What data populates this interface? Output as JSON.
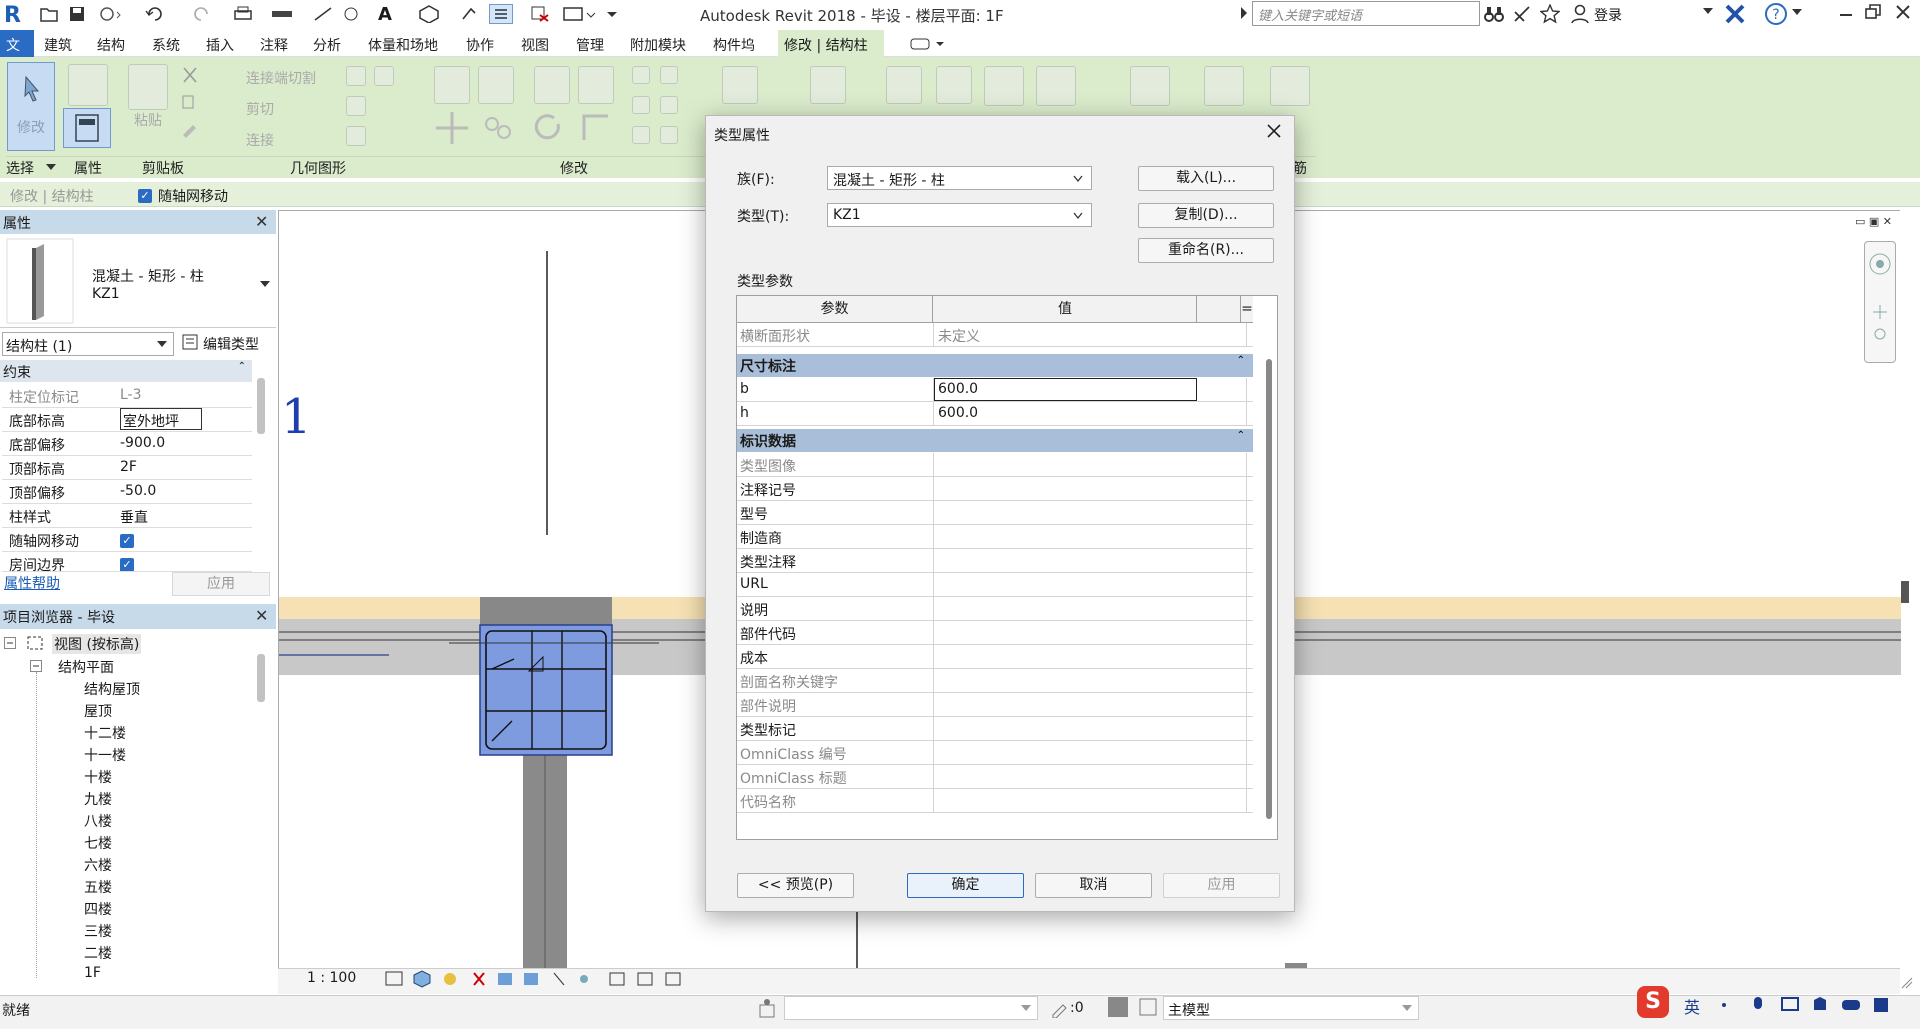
{
  "app": {
    "title": "Autodesk Revit 2018 -    毕设 - 楼层平面: 1F",
    "search_placeholder": "键入关键字或短语",
    "login": "登录",
    "logo": "R"
  },
  "menu": {
    "file": "文件",
    "items": [
      "建筑",
      "结构",
      "系统",
      "插入",
      "注释",
      "分析",
      "体量和场地",
      "协作",
      "视图",
      "管理",
      "附加模块",
      "构件坞"
    ],
    "active": "修改 | 结构柱"
  },
  "ribbon": {
    "modify_label": "修改",
    "paste_label": "粘贴",
    "cut_join": "连接端切割",
    "cut": "剪切",
    "join": "连接",
    "panel_labels": {
      "select": "选择",
      "props": "属性",
      "clipboard": "剪贴板",
      "geometry": "几何图形",
      "modify": "修改",
      "right": "筋"
    }
  },
  "options_bar": {
    "context": "修改 | 结构柱",
    "move_with_grids": "随轴网移动"
  },
  "properties": {
    "title": "属性",
    "family": "混凝土 - 矩形 - 柱",
    "type": "KZ1",
    "filter": "结构柱 (1)",
    "edit_type": "编辑类型",
    "section": "约束",
    "rows": [
      {
        "k": "柱定位标记",
        "v": "L-3",
        "gray": true
      },
      {
        "k": "底部标高",
        "v": "室外地坪"
      },
      {
        "k": "底部偏移",
        "v": "-900.0"
      },
      {
        "k": "顶部标高",
        "v": "2F"
      },
      {
        "k": "顶部偏移",
        "v": "-50.0"
      },
      {
        "k": "柱样式",
        "v": "垂直"
      },
      {
        "k": "随轴网移动",
        "v": "✓"
      },
      {
        "k": "房间边界",
        "v": "✓"
      }
    ],
    "help": "属性帮助",
    "apply": "应用"
  },
  "browser": {
    "title": "项目浏览器 - 毕设",
    "root": "视图 (按标高)",
    "group": "结构平面",
    "items": [
      "结构屋顶",
      "屋顶",
      "十二楼",
      "十一楼",
      "十楼",
      "九楼",
      "八楼",
      "七楼",
      "六楼",
      "五楼",
      "四楼",
      "三楼",
      "二楼",
      "1F"
    ]
  },
  "view": {
    "grid_label": "1",
    "scale": "1 : 100"
  },
  "dialog": {
    "title": "类型属性",
    "family_label": "族(F):",
    "family_value": "混凝土 - 矩形 - 柱",
    "type_label": "类型(T):",
    "type_value": "KZ1",
    "load": "载入(L)...",
    "duplicate": "复制(D)...",
    "rename": "重命名(R)...",
    "params_label": "类型参数",
    "col_param": "参数",
    "col_value": "值",
    "col_eq": "=",
    "top_row": {
      "k": "横断面形状",
      "v": "未定义"
    },
    "section1": "尺寸标注",
    "dims": [
      {
        "k": "b",
        "v": "600.0"
      },
      {
        "k": "h",
        "v": "600.0"
      }
    ],
    "section2": "标识数据",
    "ident": [
      {
        "k": "类型图像",
        "gray": true
      },
      {
        "k": "注释记号"
      },
      {
        "k": "型号"
      },
      {
        "k": "制造商"
      },
      {
        "k": "类型注释"
      },
      {
        "k": "URL"
      },
      {
        "k": "说明"
      },
      {
        "k": "部件代码"
      },
      {
        "k": "成本"
      },
      {
        "k": "剖面名称关键字",
        "gray": true
      },
      {
        "k": "部件说明",
        "gray": true
      },
      {
        "k": "类型标记"
      },
      {
        "k": "OmniClass 编号",
        "gray": true
      },
      {
        "k": "OmniClass 标题",
        "gray": true
      },
      {
        "k": "代码名称",
        "gray": true
      }
    ],
    "preview": "<< 预览(P)",
    "ok": "确定",
    "cancel": "取消",
    "apply": "应用"
  },
  "status": {
    "text": "就绪",
    "zero": ":0",
    "model": "主模型",
    "ime": "英"
  },
  "colors": {
    "ribbon": "#dbeccc",
    "section": "#a9bfd9",
    "column_fill": "#7f9be0",
    "accent": "#2a6cc4"
  }
}
